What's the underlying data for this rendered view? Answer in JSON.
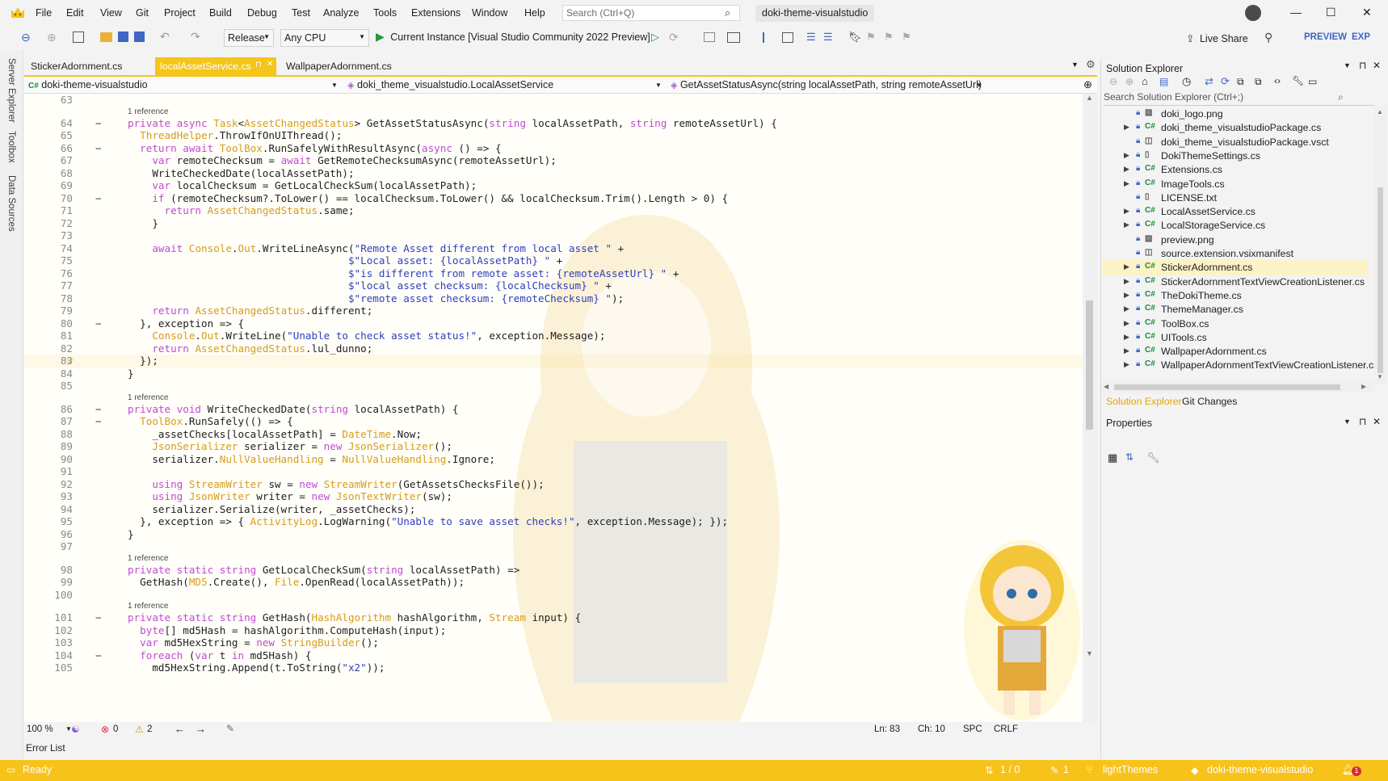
{
  "menu": [
    "File",
    "Edit",
    "View",
    "Git",
    "Project",
    "Build",
    "Debug",
    "Test",
    "Analyze",
    "Tools",
    "Extensions",
    "Window",
    "Help"
  ],
  "search": {
    "placeholder": "Search (Ctrl+Q)"
  },
  "solution_name": "doki-theme-visualstudio",
  "toolbar": {
    "config": "Release",
    "platform": "Any CPU",
    "run": "Current Instance [Visual Studio Community 2022 Preview]",
    "live_share": "Live Share",
    "preview": "PREVIEW",
    "exp": "EXP"
  },
  "rail": [
    "Server Explorer",
    "Toolbox",
    "Data Sources"
  ],
  "tabs": [
    "StickerAdornment.cs",
    "localAssetService.cs",
    "WallpaperAdornment.cs"
  ],
  "nav": {
    "project": "doki-theme-visualstudio",
    "class": "doki_theme_visualstudio.LocalAssetService",
    "member": "GetAssetStatusAsync(string localAssetPath, string remoteAssetUrl)"
  },
  "reference_label": "1 reference",
  "code": [
    {
      "n": "63",
      "text": ""
    },
    {
      "n": "64",
      "ref": true,
      "text": "private async Task<AssetChangedStatus> GetAssetStatusAsync(string localAssetPath, string remoteAssetUrl) {",
      "fold": true
    },
    {
      "n": "65",
      "text": "  ThreadHelper.ThrowIfOnUIThread();"
    },
    {
      "n": "66",
      "text": "  return await ToolBox.RunSafelyWithResultAsync(async () => {",
      "fold": true
    },
    {
      "n": "67",
      "text": "    var remoteChecksum = await GetRemoteChecksumAsync(remoteAssetUrl);"
    },
    {
      "n": "68",
      "text": "    WriteCheckedDate(localAssetPath);"
    },
    {
      "n": "69",
      "text": "    var localChecksum = GetLocalCheckSum(localAssetPath);"
    },
    {
      "n": "70",
      "text": "    if (remoteChecksum?.ToLower() == localChecksum.ToLower() && localChecksum.Trim().Length > 0) {",
      "fold": true
    },
    {
      "n": "71",
      "text": "      return AssetChangedStatus.same;"
    },
    {
      "n": "72",
      "text": "    }"
    },
    {
      "n": "73",
      "text": ""
    },
    {
      "n": "74",
      "text": "    await Console.Out.WriteLineAsync(\"Remote Asset different from local asset \" +"
    },
    {
      "n": "75",
      "text": "                                    $\"Local asset: {localAssetPath} \" +"
    },
    {
      "n": "76",
      "text": "                                    $\"is different from remote asset: {remoteAssetUrl} \" +"
    },
    {
      "n": "77",
      "text": "                                    $\"local asset checksum: {localChecksum} \" +"
    },
    {
      "n": "78",
      "text": "                                    $\"remote asset checksum: {remoteChecksum} \");"
    },
    {
      "n": "79",
      "text": "    return AssetChangedStatus.different;"
    },
    {
      "n": "80",
      "text": "  }, exception => {",
      "fold": true
    },
    {
      "n": "81",
      "text": "    Console.Out.WriteLine(\"Unable to check asset status!\", exception.Message);"
    },
    {
      "n": "82",
      "text": "    return AssetChangedStatus.lul_dunno;"
    },
    {
      "n": "83",
      "text": "  });"
    },
    {
      "n": "84",
      "text": "}"
    },
    {
      "n": "85",
      "text": ""
    },
    {
      "n": "86",
      "ref": true,
      "text": "private void WriteCheckedDate(string localAssetPath) {",
      "fold": true
    },
    {
      "n": "87",
      "text": "  ToolBox.RunSafely(() => {",
      "fold": true
    },
    {
      "n": "88",
      "text": "    _assetChecks[localAssetPath] = DateTime.Now;"
    },
    {
      "n": "89",
      "text": "    JsonSerializer serializer = new JsonSerializer();"
    },
    {
      "n": "90",
      "text": "    serializer.NullValueHandling = NullValueHandling.Ignore;"
    },
    {
      "n": "91",
      "text": ""
    },
    {
      "n": "92",
      "text": "    using StreamWriter sw = new StreamWriter(GetAssetsChecksFile());"
    },
    {
      "n": "93",
      "text": "    using JsonWriter writer = new JsonTextWriter(sw);"
    },
    {
      "n": "94",
      "text": "    serializer.Serialize(writer, _assetChecks);"
    },
    {
      "n": "95",
      "text": "  }, exception => { ActivityLog.LogWarning(\"Unable to save asset checks!\", exception.Message); });"
    },
    {
      "n": "96",
      "text": "}"
    },
    {
      "n": "97",
      "text": ""
    },
    {
      "n": "98",
      "ref": true,
      "text": "private static string GetLocalCheckSum(string localAssetPath) =>"
    },
    {
      "n": "99",
      "text": "  GetHash(MD5.Create(), File.OpenRead(localAssetPath));"
    },
    {
      "n": "100",
      "text": ""
    },
    {
      "n": "101",
      "ref": true,
      "text": "private static string GetHash(HashAlgorithm hashAlgorithm, Stream input) {",
      "fold": true
    },
    {
      "n": "102",
      "text": "  byte[] md5Hash = hashAlgorithm.ComputeHash(input);"
    },
    {
      "n": "103",
      "text": "  var md5HexString = new StringBuilder();"
    },
    {
      "n": "104",
      "text": "  foreach (var t in md5Hash) {",
      "fold": true
    },
    {
      "n": "105",
      "text": "    md5HexString.Append(t.ToString(\"x2\"));"
    }
  ],
  "editor_status": {
    "zoom": "100 %",
    "errors": "0",
    "warnings": "2",
    "ln": "Ln: 83",
    "ch": "Ch: 10",
    "spc": "SPC",
    "crlf": "CRLF"
  },
  "error_list": "Error List",
  "solution_explorer": {
    "title": "Solution Explorer",
    "search_placeholder": "Search Solution Explorer (Ctrl+;)",
    "items": [
      {
        "label": "doki_logo.png",
        "icon": "img",
        "arrow": false
      },
      {
        "label": "doki_theme_visualstudioPackage.cs",
        "icon": "C#",
        "arrow": true
      },
      {
        "label": "doki_theme_visualstudioPackage.vsct",
        "icon": "xml",
        "arrow": false
      },
      {
        "label": "DokiThemeSettings.cs",
        "icon": "cs",
        "arrow": true
      },
      {
        "label": "Extensions.cs",
        "icon": "C#",
        "arrow": true
      },
      {
        "label": "ImageTools.cs",
        "icon": "C#",
        "arrow": true
      },
      {
        "label": "LICENSE.txt",
        "icon": "txt",
        "arrow": false
      },
      {
        "label": "LocalAssetService.cs",
        "icon": "C#",
        "arrow": true
      },
      {
        "label": "LocalStorageService.cs",
        "icon": "C#",
        "arrow": true
      },
      {
        "label": "preview.png",
        "icon": "img",
        "arrow": false
      },
      {
        "label": "source.extension.vsixmanifest",
        "icon": "xml",
        "arrow": false
      },
      {
        "label": "StickerAdornment.cs",
        "icon": "C#",
        "arrow": true,
        "selected": true
      },
      {
        "label": "StickerAdornmentTextViewCreationListener.cs",
        "icon": "C#",
        "arrow": true
      },
      {
        "label": "TheDokiTheme.cs",
        "icon": "C#",
        "arrow": true
      },
      {
        "label": "ThemeManager.cs",
        "icon": "C#",
        "arrow": true
      },
      {
        "label": "ToolBox.cs",
        "icon": "C#",
        "arrow": true
      },
      {
        "label": "UITools.cs",
        "icon": "C#",
        "arrow": true
      },
      {
        "label": "WallpaperAdornment.cs",
        "icon": "C#",
        "arrow": true
      },
      {
        "label": "WallpaperAdornmentTextViewCreationListener.cs",
        "icon": "C#",
        "arrow": true
      }
    ],
    "tabs": [
      "Solution Explorer",
      "Git Changes"
    ]
  },
  "properties": {
    "title": "Properties"
  },
  "statusbar": {
    "ready": "Ready",
    "updown": "1 / 0",
    "pencil": "1",
    "branch": "lightThemes",
    "repo": "doki-theme-visualstudio",
    "bell": "1"
  },
  "colors": {
    "accent": "#f5c518",
    "status": "#f7c31a"
  }
}
